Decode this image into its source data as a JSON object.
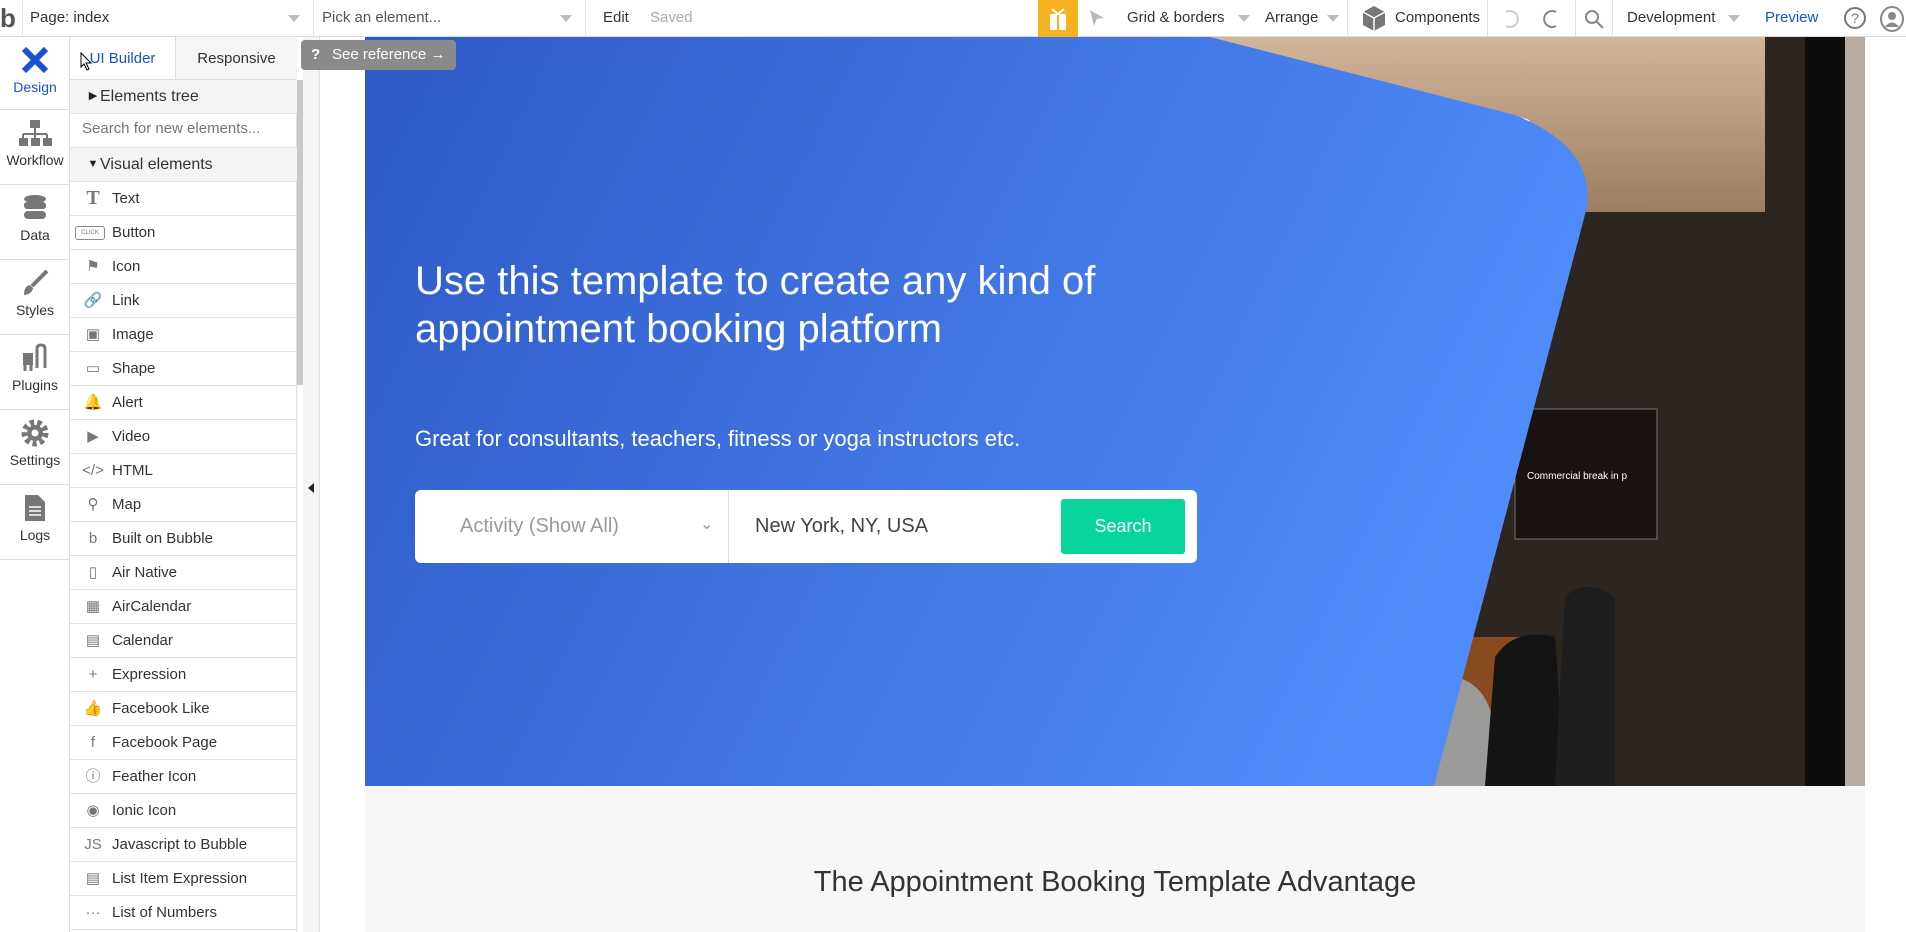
{
  "topbar": {
    "page_label": "Page: index",
    "element_picker": "Pick an element...",
    "edit": "Edit",
    "saved": "Saved",
    "grid_borders": "Grid & borders",
    "arrange": "Arrange",
    "components": "Components",
    "environment": "Development",
    "preview": "Preview"
  },
  "nav": [
    {
      "label": "Design"
    },
    {
      "label": "Workflow"
    },
    {
      "label": "Data"
    },
    {
      "label": "Styles"
    },
    {
      "label": "Plugins"
    },
    {
      "label": "Settings"
    },
    {
      "label": "Logs"
    }
  ],
  "panel": {
    "tabs": [
      "UI Builder",
      "Responsive"
    ],
    "elements_tree": "Elements tree",
    "search_placeholder": "Search for new elements...",
    "visual_elements": "Visual elements",
    "items": [
      {
        "icon": "T",
        "label": "Text"
      },
      {
        "icon": "CLICK",
        "label": "Button"
      },
      {
        "icon": "⚑",
        "label": "Icon"
      },
      {
        "icon": "🔗",
        "label": "Link"
      },
      {
        "icon": "▣",
        "label": "Image"
      },
      {
        "icon": "▭",
        "label": "Shape"
      },
      {
        "icon": "🔔",
        "label": "Alert"
      },
      {
        "icon": "▶",
        "label": "Video"
      },
      {
        "icon": "</>",
        "label": "HTML"
      },
      {
        "icon": "⚲",
        "label": "Map"
      },
      {
        "icon": "b",
        "label": "Built on Bubble"
      },
      {
        "icon": "▯",
        "label": "Air Native"
      },
      {
        "icon": "▦",
        "label": "AirCalendar"
      },
      {
        "icon": "▤",
        "label": "Calendar"
      },
      {
        "icon": "+",
        "label": "Expression"
      },
      {
        "icon": "👍",
        "label": "Facebook Like"
      },
      {
        "icon": "f",
        "label": "Facebook Page"
      },
      {
        "icon": "ⓘ",
        "label": "Feather Icon"
      },
      {
        "icon": "◉",
        "label": "Ionic Icon"
      },
      {
        "icon": "JS",
        "label": "Javascript to Bubble"
      },
      {
        "icon": "▤",
        "label": "List Item Expression"
      },
      {
        "icon": "···",
        "label": "List of Numbers"
      }
    ]
  },
  "tooltip": {
    "help": "?",
    "text": "See reference →"
  },
  "hero": {
    "headline_line1": "Use this template to create any kind of",
    "headline_line2": "appointment booking platform",
    "subtitle": "Great for consultants, teachers, fitness or yoga instructors etc.",
    "activity_select": "Activity (Show All)",
    "location_input": "New York, NY, USA",
    "search_button": "Search",
    "tv_text": "Commercial break in p"
  },
  "section": {
    "heading": "The Appointment Booking Template Advantage"
  },
  "colors": {
    "accent": "#1a4fd6",
    "gift": "#f5b21e",
    "search_button": "#07d59b",
    "hero_left": "#2e59c6",
    "hero_right": "#4e8cf8"
  }
}
